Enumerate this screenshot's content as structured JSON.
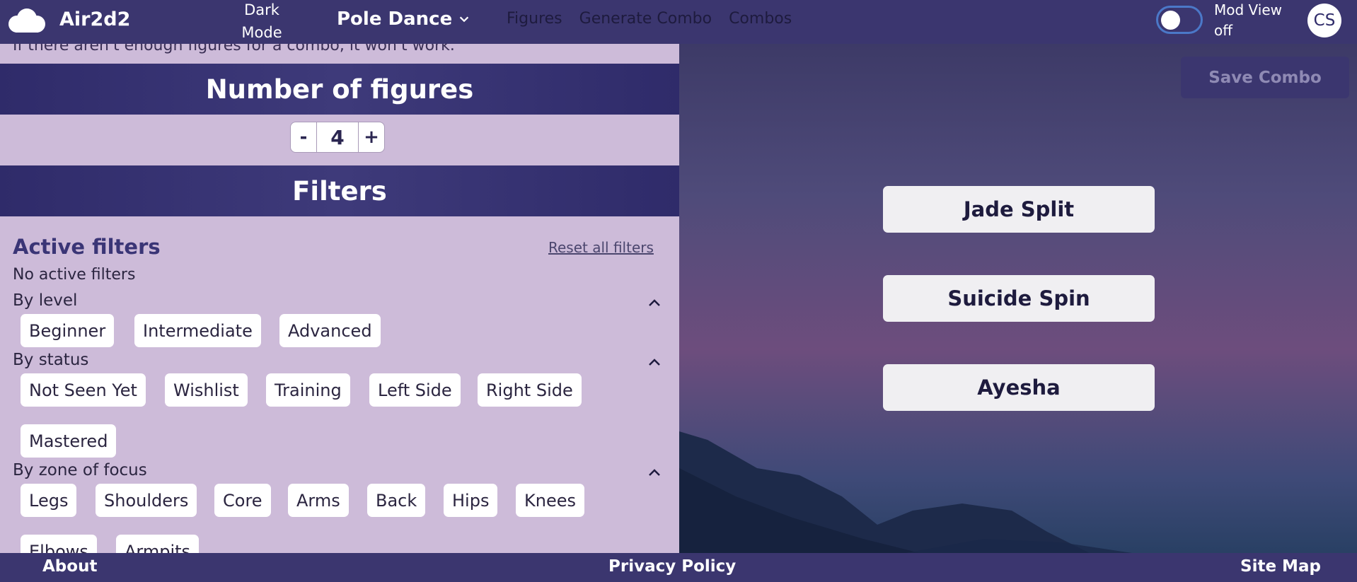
{
  "header": {
    "brand": "Air2d2",
    "dark_mode": "Dark Mode",
    "sport": "Pole Dance",
    "nav": [
      "Figures",
      "Generate Combo",
      "Combos"
    ],
    "mod_view": "Mod View off",
    "avatar": "CS"
  },
  "left": {
    "partial_text": "If there aren't enough figures for a combo, it won't work.",
    "number_title": "Number of figures",
    "stepper": {
      "minus": "-",
      "value": "4",
      "plus": "+"
    },
    "filters_title": "Filters",
    "active_filters_title": "Active filters",
    "reset_label": "Reset all filters",
    "no_active": "No active filters",
    "groups": [
      {
        "label": "By level",
        "chips": [
          "Beginner",
          "Intermediate",
          "Advanced"
        ]
      },
      {
        "label": "By status",
        "chips": [
          "Not Seen Yet",
          "Wishlist",
          "Training",
          "Left Side",
          "Right Side",
          "Mastered"
        ]
      },
      {
        "label": "By zone of focus",
        "chips": [
          "Legs",
          "Shoulders",
          "Core",
          "Arms",
          "Back",
          "Hips",
          "Knees",
          "Elbows",
          "Armpits"
        ]
      }
    ]
  },
  "right": {
    "save_label": "Save Combo",
    "combo": [
      "Jade Split",
      "Suicide Spin",
      "Ayesha"
    ]
  },
  "footer": {
    "about": "About",
    "privacy": "Privacy Policy",
    "sitemap": "Site Map"
  },
  "colors": {
    "header_bg": "#3b366f",
    "panel_bg": "#cdbbd9",
    "band_bg": "#2f2b6a",
    "accent_title": "#3a3576"
  }
}
